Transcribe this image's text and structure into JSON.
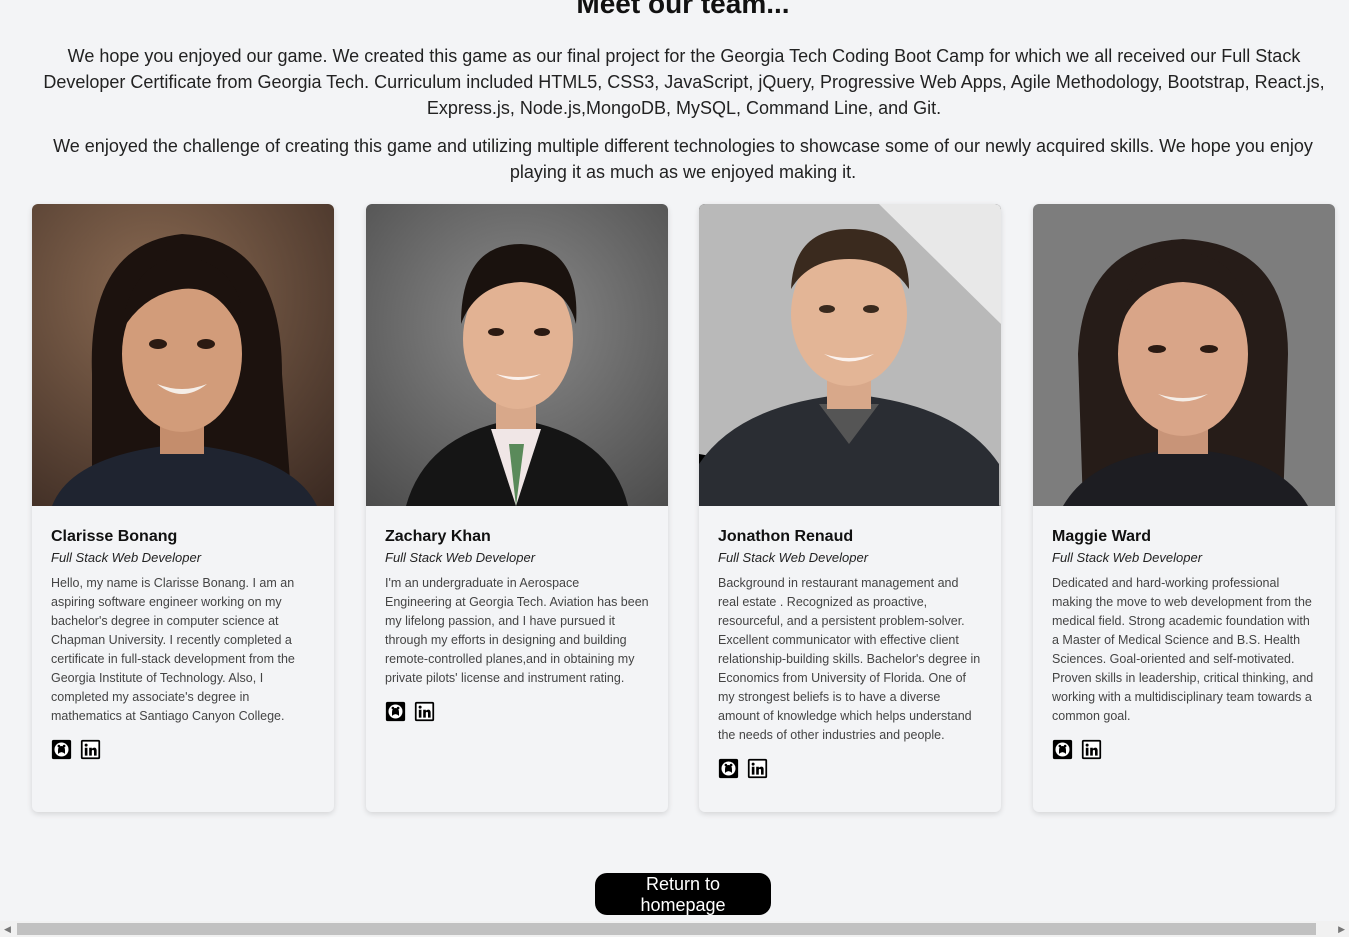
{
  "page": {
    "title": "Meet our team...",
    "intro_1": "We hope you enjoyed our game. We created this game as our final project for the Georgia Tech Coding Boot Camp for which we all received our Full Stack Developer Certificate from Georgia Tech. Curriculum included HTML5, CSS3, JavaScript, jQuery, Progressive Web Apps, Agile Methodology, Bootstrap, React.js, Express.js, Node.js,MongoDB, MySQL, Command Line, and Git.",
    "intro_2": "We enjoyed the challenge of creating this game and utilizing multiple different technologies to showcase some of our newly acquired skills. We hope you enjoy playing it as much as we enjoyed making it."
  },
  "team": [
    {
      "name": "Clarisse Bonang",
      "role": "Full Stack Web Developer",
      "bio": "Hello, my name is Clarisse Bonang. I am an aspiring software engineer working on my bachelor's degree in computer science at Chapman University. I recently completed a certificate in full-stack development from the Georgia Institute of Technology. Also, I completed my associate's degree in mathematics at Santiago Canyon College.",
      "icons": [
        "github-icon",
        "linkedin-icon"
      ]
    },
    {
      "name": "Zachary Khan",
      "role": "Full Stack Web Developer",
      "bio": "I'm an undergraduate in Aerospace Engineering at Georgia Tech. Aviation has been my lifelong passion, and I have pursued it through my efforts in designing and building remote-controlled planes,and in obtaining my private pilots' license and instrument rating.",
      "icons": [
        "github-icon",
        "linkedin-icon"
      ]
    },
    {
      "name": "Jonathon Renaud",
      "role": "Full Stack Web Developer",
      "bio": "Background in restaurant management and real estate . Recognized as proactive, resourceful, and a persistent problem-solver. Excellent communicator with effective client relationship-building skills. Bachelor's degree in Economics from University of Florida. One of my strongest beliefs is to have a diverse amount of knowledge which helps understand the needs of other industries and people.",
      "icons": [
        "github-icon",
        "linkedin-icon"
      ]
    },
    {
      "name": "Maggie Ward",
      "role": "Full Stack Web Developer",
      "bio": "Dedicated and hard-working professional making the move to web development from the medical field. Strong academic foundation with a Master of Medical Science and B.S. Health Sciences. Goal-oriented and self-motivated. Proven skills in leadership, critical thinking, and working with a multidisciplinary team towards a common goal.",
      "icons": [
        "github-icon",
        "linkedin-icon"
      ]
    }
  ],
  "footer": {
    "return_label": "Return to homepage"
  },
  "colors": {
    "background": "#f3f4f6",
    "button": "#000000",
    "button_text": "#ffffff"
  }
}
